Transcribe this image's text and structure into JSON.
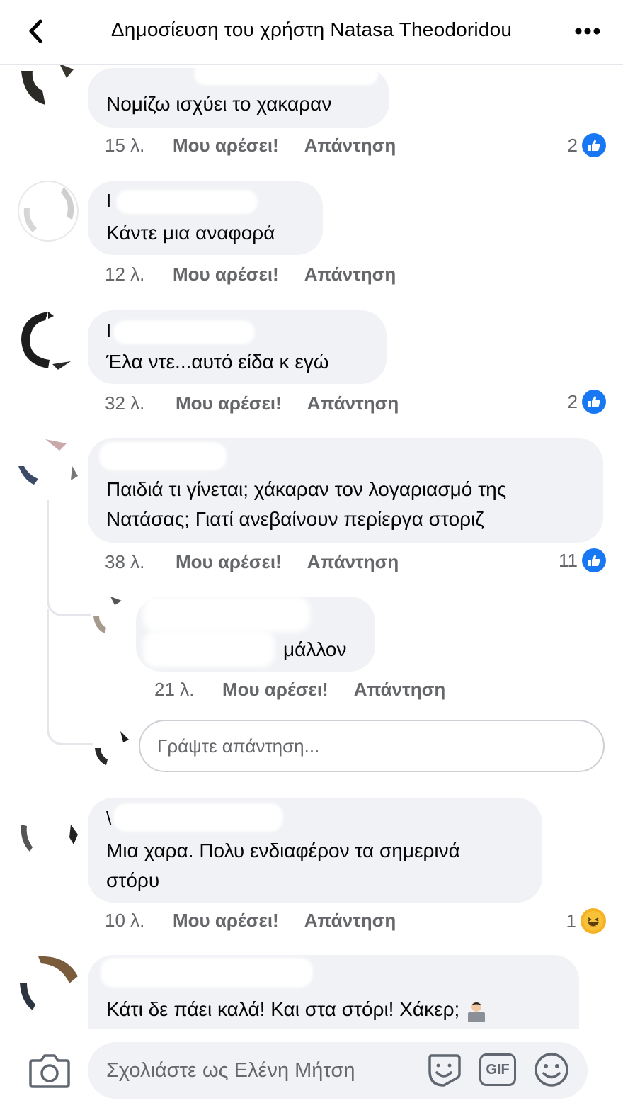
{
  "header": {
    "title": "Δημοσίευση του χρήστη Natasa Theodoridou"
  },
  "actions": {
    "like": "Μου αρέσει!",
    "reply": "Απάντηση"
  },
  "comments": [
    {
      "author_initial": "",
      "text": "Νομίζω ισχύει το χακαραν",
      "time": "15 λ.",
      "reaction_count": "2",
      "reaction": "like"
    },
    {
      "author_initial": "Ι",
      "text": "Κάντε μια αναφορά",
      "time": "12 λ.",
      "reaction_count": "",
      "reaction": ""
    },
    {
      "author_initial": "Ι",
      "text": "Έλα ντε...αυτό είδα κ εγώ",
      "time": "32 λ.",
      "reaction_count": "2",
      "reaction": "like"
    },
    {
      "author_initial": "",
      "text": "Παιδιά τι γίνεται; χάκαραν τον λογαριασμό της\nΝατάσας; Γιατί ανεβαίνουν περίεργα στοριζ",
      "time": "38 λ.",
      "reaction_count": "11",
      "reaction": "like"
    },
    {
      "author_initial": "",
      "text": "μάλλον",
      "time": "21 λ.",
      "reaction_count": "",
      "reaction": ""
    },
    {
      "author_initial": "\\",
      "text": "Μια χαρα. Πολυ ενδιαφέρον τα σημερινά\nστόρυ",
      "time": "10 λ.",
      "reaction_count": "1",
      "reaction": "haha"
    },
    {
      "author_initial": "",
      "text": "Κάτι δε πάει καλά! Και στα στόρι! Χάκερ;",
      "time": "",
      "reaction_count": "",
      "reaction": ""
    }
  ],
  "reply_input": {
    "placeholder": "Γράψτε απάντηση..."
  },
  "composer": {
    "placeholder": "Σχολιάστε ως Ελένη Μήτση",
    "gif_label": "GIF"
  },
  "icons": {
    "back": "chevron-left-icon",
    "more": "more-horizontal-icon",
    "camera": "camera-icon",
    "sticker": "sticker-icon",
    "gif": "gif-icon",
    "emoji": "emoji-icon",
    "like": "like-thumb-icon",
    "haha": "haha-emoji-icon"
  },
  "colors": {
    "like_blue": "#1877f2",
    "bubble": "#f0f2f5",
    "secondary_text": "#65676b"
  }
}
